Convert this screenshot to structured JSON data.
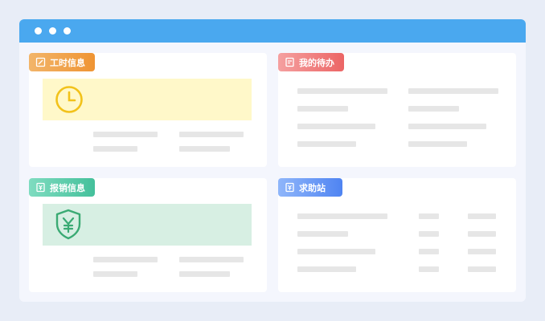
{
  "window": {
    "titlebar_color": "#4aa8ef",
    "dots": [
      "dot",
      "dot",
      "dot"
    ]
  },
  "cards": {
    "work_hours": {
      "title": "工时信息",
      "icon": "edit-icon",
      "tag_color": "#f0a040",
      "banner_color": "#fff8c9",
      "banner_icon": "clock-icon",
      "banner_icon_color": "#f2c21a"
    },
    "todo": {
      "title": "我的待办",
      "icon": "note-icon",
      "tag_color": "#ee6b6b"
    },
    "reimbursement": {
      "title": "报销信息",
      "icon": "receipt-icon",
      "tag_color": "#4fc9a5",
      "banner_color": "#d7efe3",
      "banner_icon": "yuan-shield-icon",
      "banner_icon_color": "#3aaa73"
    },
    "help": {
      "title": "求助站",
      "icon": "receipt-icon",
      "tag_color": "#5b8ff5"
    }
  }
}
